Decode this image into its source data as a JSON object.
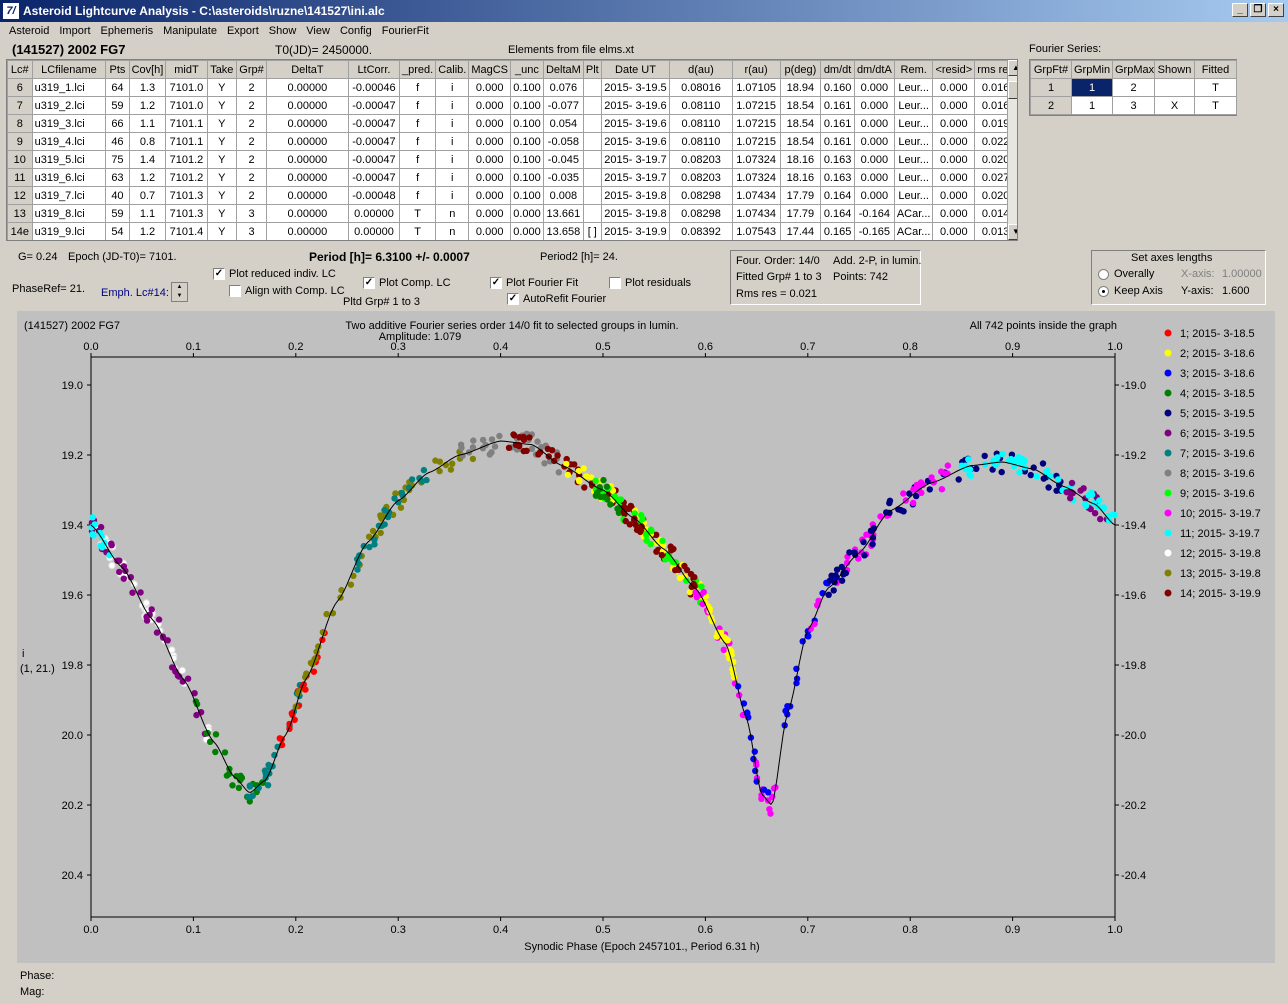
{
  "window": {
    "title": "Asteroid Lightcurve Analysis - C:\\asteroids\\ruzne\\141527\\ini.alc",
    "icon_text": "7/"
  },
  "menu": [
    "Asteroid",
    "Import",
    "Ephemeris",
    "Manipulate",
    "Export",
    "Show",
    "View",
    "Config",
    "FourierFit"
  ],
  "header": {
    "asteroid": "(141527) 2002 FG7",
    "t0": "T0(JD)= 2450000.",
    "elements": "Elements from file elms.xt"
  },
  "lc_table": {
    "columns": [
      "Lc#",
      "LCfilename",
      "Pts",
      "Cov[h]",
      "midT",
      "Take",
      "Grp#",
      "DeltaT",
      "LtCorr.",
      "_pred.",
      "Calib.",
      "MagCS",
      "_unc",
      "DeltaM",
      "Plt",
      "Date UT",
      "d(au)",
      "r(au)",
      "p(deg)",
      "dm/dt",
      "dm/dtA",
      "Rem.",
      "<resid>",
      "rms res"
    ],
    "rows": [
      [
        "6",
        "u319_1.lci",
        "64",
        "1.3",
        "7101.0",
        "Y",
        "2",
        "0.00000",
        "-0.00046",
        "f",
        "i",
        "0.000",
        "0.100",
        "0.076",
        "",
        "2015- 3-19.5",
        "0.08016",
        "1.07105",
        "18.94",
        "0.160",
        "0.000",
        "Leur...",
        "0.000",
        "0.016"
      ],
      [
        "7",
        "u319_2.lci",
        "59",
        "1.2",
        "7101.0",
        "Y",
        "2",
        "0.00000",
        "-0.00047",
        "f",
        "i",
        "0.000",
        "0.100",
        "-0.077",
        "",
        "2015- 3-19.6",
        "0.08110",
        "1.07215",
        "18.54",
        "0.161",
        "0.000",
        "Leur...",
        "0.000",
        "0.016"
      ],
      [
        "8",
        "u319_3.lci",
        "66",
        "1.1",
        "7101.1",
        "Y",
        "2",
        "0.00000",
        "-0.00047",
        "f",
        "i",
        "0.000",
        "0.100",
        "0.054",
        "",
        "2015- 3-19.6",
        "0.08110",
        "1.07215",
        "18.54",
        "0.161",
        "0.000",
        "Leur...",
        "0.000",
        "0.019"
      ],
      [
        "9",
        "u319_4.lci",
        "46",
        "0.8",
        "7101.1",
        "Y",
        "2",
        "0.00000",
        "-0.00047",
        "f",
        "i",
        "0.000",
        "0.100",
        "-0.058",
        "",
        "2015- 3-19.6",
        "0.08110",
        "1.07215",
        "18.54",
        "0.161",
        "0.000",
        "Leur...",
        "0.000",
        "0.022"
      ],
      [
        "10",
        "u319_5.lci",
        "75",
        "1.4",
        "7101.2",
        "Y",
        "2",
        "0.00000",
        "-0.00047",
        "f",
        "i",
        "0.000",
        "0.100",
        "-0.045",
        "",
        "2015- 3-19.7",
        "0.08203",
        "1.07324",
        "18.16",
        "0.163",
        "0.000",
        "Leur...",
        "0.000",
        "0.020"
      ],
      [
        "11",
        "u319_6.lci",
        "63",
        "1.2",
        "7101.2",
        "Y",
        "2",
        "0.00000",
        "-0.00047",
        "f",
        "i",
        "0.000",
        "0.100",
        "-0.035",
        "",
        "2015- 3-19.7",
        "0.08203",
        "1.07324",
        "18.16",
        "0.163",
        "0.000",
        "Leur...",
        "0.000",
        "0.027"
      ],
      [
        "12",
        "u319_7.lci",
        "40",
        "0.7",
        "7101.3",
        "Y",
        "2",
        "0.00000",
        "-0.00048",
        "f",
        "i",
        "0.000",
        "0.100",
        "0.008",
        "",
        "2015- 3-19.8",
        "0.08298",
        "1.07434",
        "17.79",
        "0.164",
        "0.000",
        "Leur...",
        "0.000",
        "0.020"
      ],
      [
        "13",
        "u319_8.lci",
        "59",
        "1.1",
        "7101.3",
        "Y",
        "3",
        "0.00000",
        "0.00000",
        "T",
        "n",
        "0.000",
        "0.000",
        "13.661",
        "",
        "2015- 3-19.8",
        "0.08298",
        "1.07434",
        "17.79",
        "0.164",
        "-0.164",
        "ACar...",
        "0.000",
        "0.014"
      ],
      [
        "14e",
        "u319_9.lci",
        "54",
        "1.2",
        "7101.4",
        "Y",
        "3",
        "0.00000",
        "0.00000",
        "T",
        "n",
        "0.000",
        "0.000",
        "13.658",
        "[ ]",
        "2015- 3-19.9",
        "0.08392",
        "1.07543",
        "17.44",
        "0.165",
        "-0.165",
        "ACar...",
        "0.000",
        "0.013"
      ]
    ]
  },
  "fourier": {
    "label": "Fourier Series:",
    "columns": [
      "GrpFt#",
      "GrpMin",
      "GrpMax",
      "Shown",
      "Fitted"
    ],
    "rows": [
      [
        "1",
        "1",
        "2",
        "",
        "T"
      ],
      [
        "2",
        "1",
        "3",
        "X",
        "T"
      ]
    ]
  },
  "controls": {
    "g": "G= 0.24",
    "epoch": "Epoch (JD-T0)= 7101.",
    "period": "Period [h]= 6.3100 +/- 0.0007",
    "period2": "Period2 [h]= 24.",
    "phaseref": "PhaseRef= 21.",
    "emph": "Emph. Lc#14:",
    "plot_reduced": "Plot reduced indiv. LC",
    "align": "Align with Comp. LC",
    "plot_comp": "Plot Comp. LC",
    "pltd_grp": "Pltd Grp#  1   to   3",
    "plot_fourier": "Plot Fourier Fit",
    "autorefit": "AutoRefit Fourier",
    "plot_resid": "Plot residuals"
  },
  "info": {
    "l1a": "Four. Order: 14/0",
    "l1b": "Add. 2-P, in lumin.",
    "l2a": "Fitted Grp# 1 to 3",
    "l2b": "Points: 742",
    "l3": "Rms res     = 0.021"
  },
  "axes": {
    "title": "Set axes lengths",
    "overally": "Overally",
    "keep": "Keep Axis",
    "xlabel": "X-axis:",
    "xval": "1.00000",
    "ylabel": "Y-axis:",
    "yval": "1.600"
  },
  "plot": {
    "name": "(141527) 2002 FG7",
    "subtitle": "Two additive Fourier series order 14/0 fit to selected groups in lumin.",
    "amplitude": "Amplitude: 1.079",
    "inside": "All 742 points inside the graph",
    "ylabel1": "i",
    "ylabel2": "(1, 21.)",
    "xlabel": "Synodic Phase (Epoch 2457101., Period 6.31 h)"
  },
  "chart_data": {
    "type": "scatter",
    "xlim": [
      0,
      1
    ],
    "ylim": [
      20.52,
      18.92
    ],
    "xticks": [
      "0.0",
      "0.1",
      "0.2",
      "0.3",
      "0.4",
      "0.5",
      "0.6",
      "0.7",
      "0.8",
      "0.9",
      "1.0"
    ],
    "yticks": [
      "19.0",
      "19.2",
      "19.4",
      "19.6",
      "19.8",
      "20.0",
      "20.2",
      "20.4"
    ],
    "fit_curve": [
      [
        0.0,
        19.4
      ],
      [
        0.03,
        19.52
      ],
      [
        0.06,
        19.67
      ],
      [
        0.09,
        19.84
      ],
      [
        0.12,
        20.02
      ],
      [
        0.14,
        20.12
      ],
      [
        0.155,
        20.165
      ],
      [
        0.17,
        20.13
      ],
      [
        0.19,
        20.0
      ],
      [
        0.21,
        19.84
      ],
      [
        0.24,
        19.62
      ],
      [
        0.27,
        19.45
      ],
      [
        0.3,
        19.33
      ],
      [
        0.33,
        19.25
      ],
      [
        0.36,
        19.2
      ],
      [
        0.4,
        19.16
      ],
      [
        0.43,
        19.17
      ],
      [
        0.46,
        19.23
      ],
      [
        0.5,
        19.3
      ],
      [
        0.53,
        19.38
      ],
      [
        0.56,
        19.47
      ],
      [
        0.59,
        19.58
      ],
      [
        0.62,
        19.74
      ],
      [
        0.64,
        19.95
      ],
      [
        0.655,
        20.17
      ],
      [
        0.665,
        20.2
      ],
      [
        0.68,
        19.94
      ],
      [
        0.7,
        19.7
      ],
      [
        0.72,
        19.58
      ],
      [
        0.75,
        19.48
      ],
      [
        0.78,
        19.36
      ],
      [
        0.82,
        19.28
      ],
      [
        0.86,
        19.23
      ],
      [
        0.89,
        19.22
      ],
      [
        0.92,
        19.24
      ],
      [
        0.95,
        19.29
      ],
      [
        0.98,
        19.34
      ],
      [
        1.0,
        19.4
      ]
    ],
    "legend": [
      {
        "name": "1; 2015- 3-18.5",
        "color": "#ff0000"
      },
      {
        "name": "2; 2015- 3-18.6",
        "color": "#ffff00"
      },
      {
        "name": "3; 2015- 3-18.6",
        "color": "#0000ff"
      },
      {
        "name": "4; 2015- 3-18.5",
        "color": "#008000"
      },
      {
        "name": "5; 2015- 3-19.5",
        "color": "#000080"
      },
      {
        "name": "6; 2015- 3-19.5",
        "color": "#800080"
      },
      {
        "name": "7; 2015- 3-19.6",
        "color": "#008080"
      },
      {
        "name": "8; 2015- 3-19.6",
        "color": "#808080"
      },
      {
        "name": "9; 2015- 3-19.6",
        "color": "#00ff00"
      },
      {
        "name": "10; 2015- 3-19.7",
        "color": "#ff00ff"
      },
      {
        "name": "11; 2015- 3-19.7",
        "color": "#00ffff"
      },
      {
        "name": "12; 2015- 3-19.8",
        "color": "#ffffff"
      },
      {
        "name": "13; 2015- 3-19.8",
        "color": "#808000"
      },
      {
        "name": "14; 2015- 3-19.9",
        "color": "#800000"
      }
    ],
    "series_ranges": [
      {
        "group": 12,
        "x": [
          0.0,
          0.12
        ]
      },
      {
        "group": 6,
        "x": [
          0.0,
          0.12
        ]
      },
      {
        "group": 11,
        "x": [
          0.0,
          0.02
        ]
      },
      {
        "group": 4,
        "x": [
          0.1,
          0.17
        ]
      },
      {
        "group": 7,
        "x": [
          0.15,
          0.21
        ]
      },
      {
        "group": 1,
        "x": [
          0.18,
          0.23
        ]
      },
      {
        "group": 13,
        "x": [
          0.2,
          0.38
        ]
      },
      {
        "group": 7,
        "x": [
          0.26,
          0.33
        ]
      },
      {
        "group": 8,
        "x": [
          0.36,
          0.46
        ]
      },
      {
        "group": 14,
        "x": [
          0.4,
          0.59
        ]
      },
      {
        "group": 2,
        "x": [
          0.46,
          0.63
        ]
      },
      {
        "group": 9,
        "x": [
          0.49,
          0.6
        ]
      },
      {
        "group": 4,
        "x": [
          0.49,
          0.52
        ]
      },
      {
        "group": 14,
        "x": [
          0.52,
          0.59
        ]
      },
      {
        "group": 10,
        "x": [
          0.59,
          0.67
        ]
      },
      {
        "group": 2,
        "x": [
          0.6,
          0.63
        ]
      },
      {
        "group": 3,
        "x": [
          0.63,
          0.73
        ]
      },
      {
        "group": 10,
        "x": [
          0.7,
          0.78
        ]
      },
      {
        "group": 5,
        "x": [
          0.72,
          0.95
        ]
      },
      {
        "group": 10,
        "x": [
          0.79,
          0.84
        ]
      },
      {
        "group": 11,
        "x": [
          0.84,
          0.96
        ]
      },
      {
        "group": 6,
        "x": [
          0.95,
          1.0
        ]
      },
      {
        "group": 11,
        "x": [
          0.97,
          1.0
        ]
      }
    ]
  },
  "status": {
    "phase": "Phase:",
    "mag": "Mag:"
  }
}
